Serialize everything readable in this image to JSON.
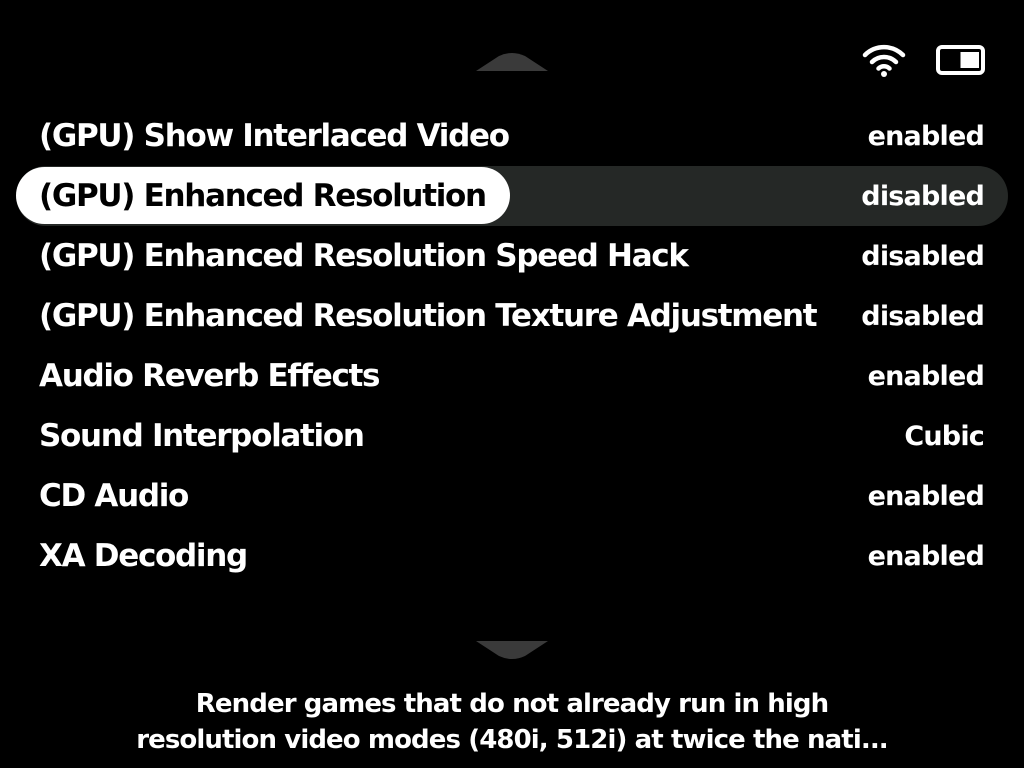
{
  "status": {
    "wifi_icon": "wifi-icon",
    "battery_icon": "battery-icon",
    "battery_level": 0.5
  },
  "menu": {
    "items": [
      {
        "label": "(GPU) Show Interlaced Video",
        "value": "enabled"
      },
      {
        "label": "(GPU) Enhanced Resolution",
        "value": "disabled"
      },
      {
        "label": "(GPU) Enhanced Resolution Speed Hack",
        "value": "disabled"
      },
      {
        "label": "(GPU) Enhanced Resolution Texture Adjustment",
        "value": "disabled"
      },
      {
        "label": "Audio Reverb Effects",
        "value": "enabled"
      },
      {
        "label": "Sound Interpolation",
        "value": "Cubic"
      },
      {
        "label": "CD Audio",
        "value": "enabled"
      },
      {
        "label": "XA Decoding",
        "value": "enabled"
      }
    ],
    "selected_index": 1
  },
  "description": {
    "line1": "Render games that do not already run in high",
    "line2": "resolution video modes (480i, 512i) at twice the nati..."
  },
  "colors": {
    "background": "#000000",
    "text": "#ffffff",
    "selected_row": "#252826",
    "selected_pill": "#ffffff",
    "scroll_arrow": "#3a3a3a"
  }
}
